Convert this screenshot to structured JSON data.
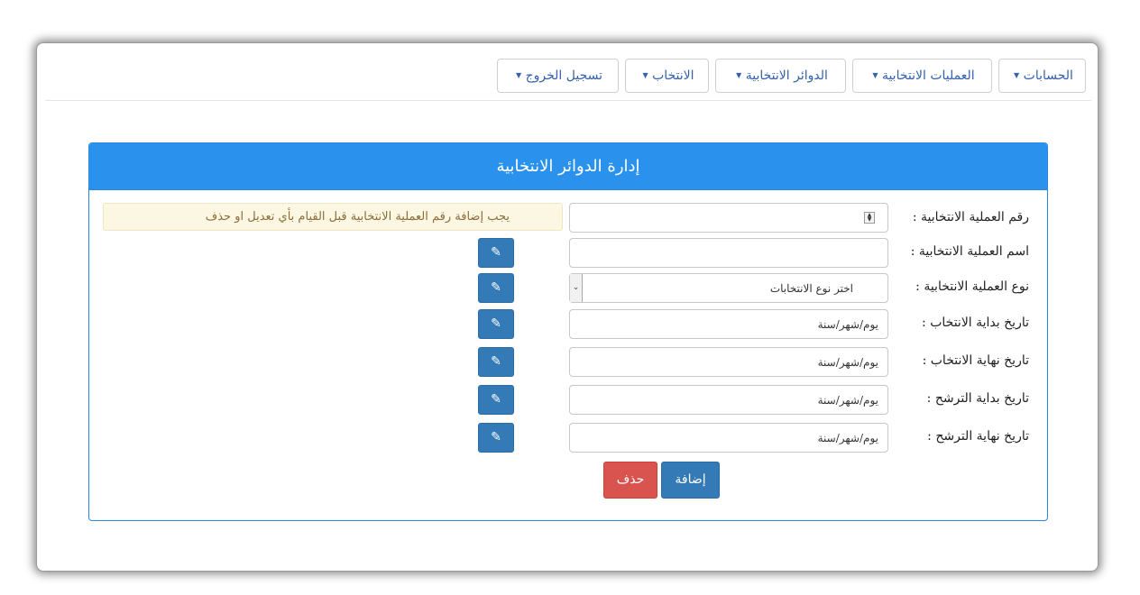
{
  "nav": {
    "accounts": "الحسابات",
    "operations": "العمليات الانتخابية",
    "districts": "الدوائر الانتخابية",
    "election": "الانتخاب",
    "logout": "تسجيل الخروج",
    "caret_icon": "caret-down-icon"
  },
  "panel": {
    "title": "إدارة الدوائر الانتخابية"
  },
  "form": {
    "operation_number_label": "رقم العملية الانتخابية :",
    "operation_number_value": "",
    "operation_name_label": "اسم العملية الانتخابية :",
    "operation_name_value": "",
    "operation_type_label": "نوع العملية الانتخابية :",
    "operation_type_selected": "اختر نوع الانتخابات",
    "election_start_label": "تاريخ بداية الانتخاب :",
    "election_start_value": "يوم/شهر/سنة",
    "election_end_label": "تاريخ نهاية الانتخاب :",
    "election_end_value": "يوم/شهر/سنة",
    "candidacy_start_label": "تاريخ بداية الترشح :",
    "candidacy_start_value": "يوم/شهر/سنة",
    "candidacy_end_label": "تاريخ نهاية الترشح :",
    "candidacy_end_value": "يوم/شهر/سنة"
  },
  "alert": {
    "message": "يجب إضافة رقم العملية الانتخابية قبل القيام بأي تعديل او حذف"
  },
  "buttons": {
    "add_label": "إضافة",
    "delete_label": "حذف",
    "edit_icon": "edit-icon"
  },
  "colors": {
    "panel_header": "#2a92ec",
    "primary": "#337ab7",
    "danger": "#d9534f",
    "alert_bg": "#fcf7e2",
    "alert_text": "#8a6d3b",
    "nav_text": "#3361ad"
  }
}
